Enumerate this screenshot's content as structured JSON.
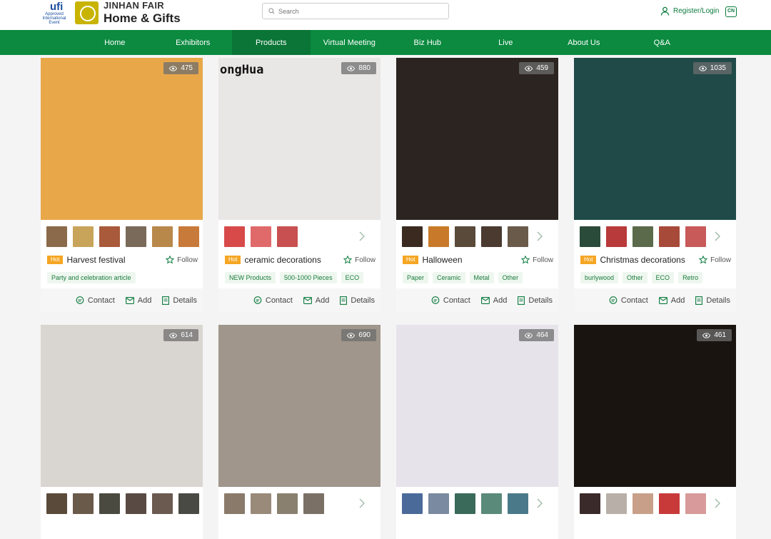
{
  "header": {
    "ufi_logo_text": "ufi",
    "ufi_sub_text": "Approved International Event",
    "brand_line1": "JINHAN FAIR",
    "brand_line2": "Home & Gifts",
    "search_placeholder": "Search",
    "login_label": "Register/Login",
    "lang_label": "CN"
  },
  "nav": {
    "items": [
      "Home",
      "Exhibitors",
      "Products",
      "Virtual Meeting",
      "Biz Hub",
      "Live",
      "About Us",
      "Q&A"
    ],
    "active": "Products"
  },
  "actions": {
    "contact": "Contact",
    "add": "Add",
    "details": "Details"
  },
  "follow_label": "Follow",
  "hot_label": "Hot",
  "products": [
    {
      "views": "475",
      "title": "Harvest festival",
      "tags": [
        "Party and celebration article"
      ],
      "photo_color": "#e8a84a",
      "thumbs": [
        "#8a6a4a",
        "#c8a45a",
        "#a85a3a",
        "#7a6a5a",
        "#b8884a",
        "#c87a3a"
      ]
    },
    {
      "views": "880",
      "title": "ceramic decorations",
      "tags": [
        "NEW Products",
        "500-1000 Pieces",
        "ECO"
      ],
      "photo_color": "#e9e6e6",
      "photo_text": "ongHua",
      "thumbs": [
        "#d84a4a",
        "#e06a6a",
        "#c85050"
      ]
    },
    {
      "views": "459",
      "title": "Halloween",
      "tags": [
        "Paper",
        "Ceramic",
        "Metal",
        "Other"
      ],
      "photo_color": "#2c2420",
      "thumbs": [
        "#3a2a20",
        "#c87a2a",
        "#5a4a3a",
        "#4a3a30",
        "#6a5a4a"
      ]
    },
    {
      "views": "1035",
      "title": "Christmas decorations",
      "tags": [
        "burlywood",
        "Other",
        "ECO",
        "Retro"
      ],
      "photo_color": "#1f4a48",
      "thumbs": [
        "#2a4a3a",
        "#b83a3a",
        "#5a6a4a",
        "#a84a3a",
        "#c85a5a"
      ]
    },
    {
      "views": "614",
      "photo_color": "#d9d6d2",
      "thumbs": [
        "#5a4a3a",
        "#6a5a4a",
        "#4a4a40",
        "#5a4a44",
        "#6a5a50",
        "#4a4a44"
      ]
    },
    {
      "views": "690",
      "photo_color": "#a0968c",
      "thumbs": [
        "#8a7a6a",
        "#9a8a7a",
        "#8a8070",
        "#7a7066"
      ]
    },
    {
      "views": "464",
      "photo_color": "#e6e4ea",
      "thumbs": [
        "#4a6a9a",
        "#7a8aa0",
        "#3a6a5a",
        "#5a8a7a",
        "#4a7a8a"
      ]
    },
    {
      "views": "461",
      "photo_color": "#1a1410",
      "thumbs": [
        "#3a2a2a",
        "#b8b0a8",
        "#c8a08a",
        "#c83a3a",
        "#d89a9a"
      ]
    }
  ]
}
